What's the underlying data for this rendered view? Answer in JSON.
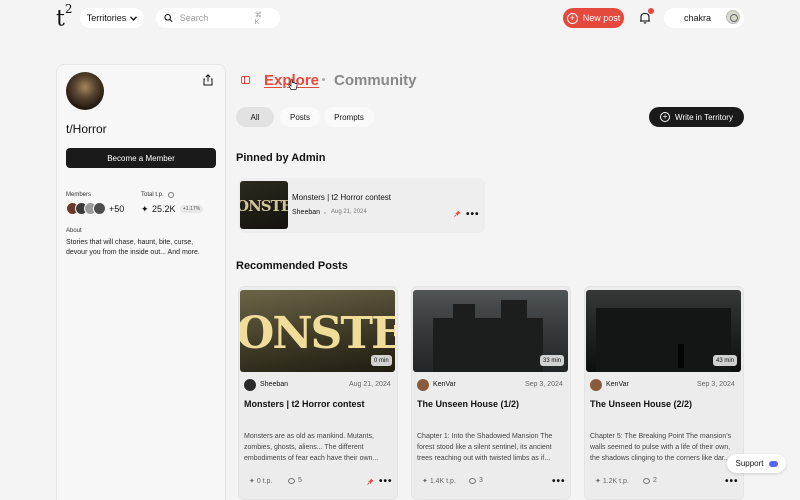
{
  "header": {
    "logo": "t",
    "logo_sup": "2",
    "territories_label": "Territories",
    "search_placeholder": "Search",
    "search_shortcut": "⌘ K",
    "new_post_label": "New post",
    "user_name": "chakra"
  },
  "territory": {
    "name": "t/Horror",
    "become_member_label": "Become a Member",
    "members_label": "Members",
    "members_extra": "+50",
    "total_tp_label": "Total t.p.",
    "total_tp_value": "25.2K",
    "total_tp_change": "+1.17%",
    "about_label": "About",
    "about_text": "Stories that will chase, haunt, bite, curse, devour you from the inside out... And more."
  },
  "main": {
    "explore_label": "Explore",
    "community_label": "Community",
    "tabs": [
      {
        "label": "All"
      },
      {
        "label": "Posts"
      },
      {
        "label": "Prompts"
      }
    ],
    "write_label": "Write in Territory",
    "pinned_heading": "Pinned by Admin",
    "recommended_heading": "Recommended Posts"
  },
  "pinned": {
    "thumb_text": "ONSTE",
    "title": "Monsters | t2 Horror contest",
    "author": "Sheeban",
    "date": "Aug 21, 2024"
  },
  "posts": [
    {
      "img_text": "ONSTEI",
      "duration": "0 min",
      "author": "Sheeban",
      "date": "Aug 21, 2024",
      "title": "Monsters | t2 Horror contest",
      "excerpt": "Monsters are as old as mankind. Mutants, zombies, ghosts, aliens... The different embodiments of fear each have their own...",
      "tp": "0 t.p.",
      "comments": "5"
    },
    {
      "duration": "33 min",
      "author": "KenVar",
      "date": "Sep 3, 2024",
      "title": "The Unseen House (1/2)",
      "excerpt": "Chapter 1: Into the Shadowed Mansion The forest stood like a silent sentinel, its ancient trees reaching out with twisted limbs as if...",
      "tp": "1.4K t.p.",
      "comments": "3"
    },
    {
      "duration": "43 min",
      "author": "KenVar",
      "date": "Sep 3, 2024",
      "title": "The Unseen House (2/2)",
      "excerpt": "Chapter 5: The Breaking Point The mansion's walls seemed to pulse with a life of their own, the shadows clinging to the corners like dar...",
      "tp": "1.2K t.p.",
      "comments": "2"
    }
  ],
  "support_label": "Support",
  "colors": {
    "accent": "#e5483d",
    "dark_button": "#1a1a1a",
    "background": "#f4f4f4"
  }
}
